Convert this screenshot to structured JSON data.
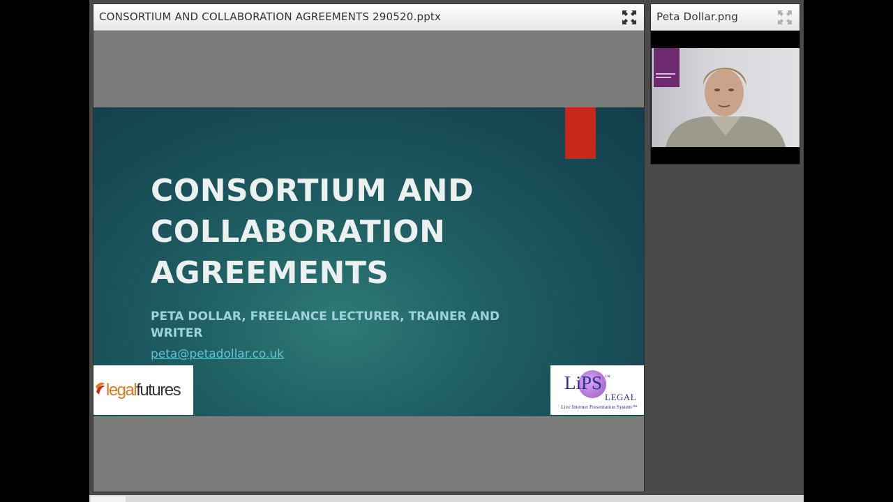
{
  "share_pod": {
    "title": "CONSORTIUM AND COLLABORATION AGREEMENTS 290520.pptx",
    "fullscreen_icon": "expand-arrows-icon"
  },
  "camera_pod": {
    "title": "Peta Dollar.png",
    "fullscreen_icon": "expand-arrows-icon"
  },
  "slide": {
    "title_lines": [
      "CONSORTIUM AND",
      "COLLABORATION",
      "AGREEMENTS"
    ],
    "subtitle_lines": [
      "PETA DOLLAR, FREELANCE LECTURER, TRAINER AND",
      "WRITER"
    ],
    "email": "peta@petadollar.co.uk",
    "logo_left": {
      "text_a": "legal",
      "text_b": "futures"
    },
    "logo_right": {
      "text_main": "LiPS",
      "text_tm": "™",
      "text_sub": "LEGAL",
      "text_tag": "Live Internet Presentation System™"
    }
  },
  "colors": {
    "accent_red": "#c8281a",
    "slide_bg": "#1f5f63",
    "email": "#5fc3d6",
    "logo_orange": "#e07a1f",
    "logo_purple": "#7b3fa0"
  }
}
